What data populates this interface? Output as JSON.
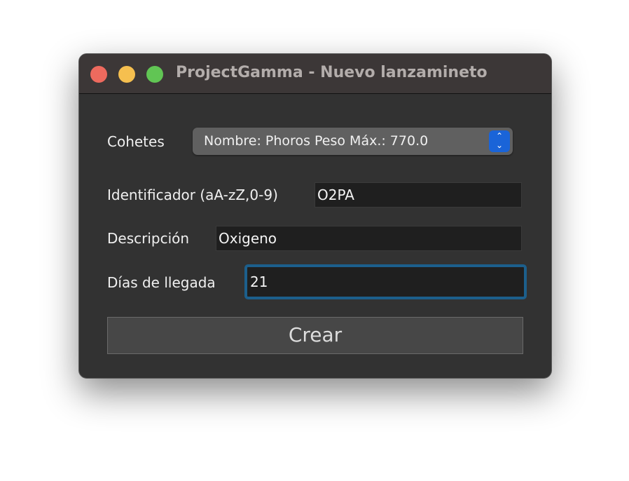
{
  "window": {
    "title": "ProjectGamma - Nuevo lanzamineto",
    "colors": {
      "close": "#ee6a5e",
      "minimize": "#f5bf4f",
      "zoom": "#61c554"
    }
  },
  "form": {
    "cohetes_label": "Cohetes",
    "cohetes_value": "Nombre: Phoros Peso Máx.: 770.0",
    "identificador_label": "Identificador (aA-zZ,0-9)",
    "identificador_value": "O2PA",
    "descripcion_label": "Descripción",
    "descripcion_value": "Oxigeno",
    "dias_label": "Días de llegada",
    "dias_value": "21",
    "crear_label": "Crear"
  }
}
